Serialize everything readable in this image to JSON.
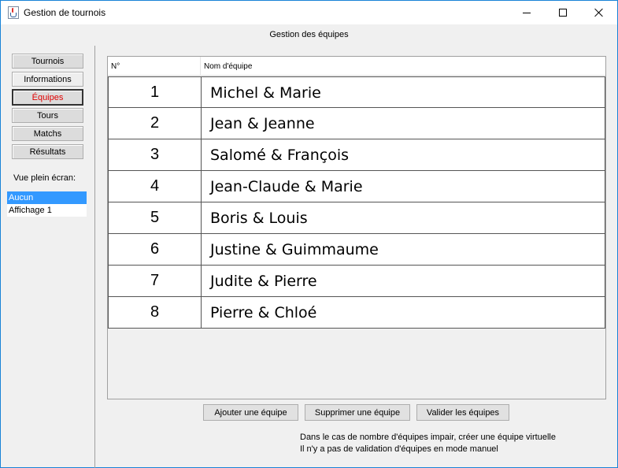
{
  "window": {
    "title": "Gestion de tournois"
  },
  "header": {
    "title": "Gestion des équipes"
  },
  "nav": {
    "items": [
      {
        "label": "Tournois"
      },
      {
        "label": "Informations"
      },
      {
        "label": "Équipes"
      },
      {
        "label": "Tours"
      },
      {
        "label": "Matchs"
      },
      {
        "label": "Résultats"
      }
    ],
    "active": "Équipes"
  },
  "fullscreen": {
    "label": "Vue plein écran:",
    "options": [
      "Aucun",
      "Affichage 1"
    ],
    "selected": "Aucun"
  },
  "table": {
    "columns": [
      "N°",
      "Nom d'équipe"
    ],
    "rows": [
      {
        "num": "1",
        "name": "Michel & Marie"
      },
      {
        "num": "2",
        "name": "Jean & Jeanne"
      },
      {
        "num": "3",
        "name": "Salomé & François"
      },
      {
        "num": "4",
        "name": "Jean-Claude & Marie"
      },
      {
        "num": "5",
        "name": "Boris & Louis"
      },
      {
        "num": "6",
        "name": "Justine & Guimmaume"
      },
      {
        "num": "7",
        "name": "Judite & Pierre"
      },
      {
        "num": "8",
        "name": "Pierre & Chloé"
      }
    ]
  },
  "actions": {
    "add": "Ajouter une équipe",
    "delete": "Supprimer une équipe",
    "validate": "Valider les équipes"
  },
  "notes": {
    "line1": "Dans le cas de nombre d'équipes impair, créer une équipe virtuelle",
    "line2": "Il n'y a pas de validation d'équipes en mode manuel"
  },
  "colors": {
    "accent_selected": "#3399ff",
    "active_nav_text": "#e00000",
    "window_border": "#1883d7"
  }
}
